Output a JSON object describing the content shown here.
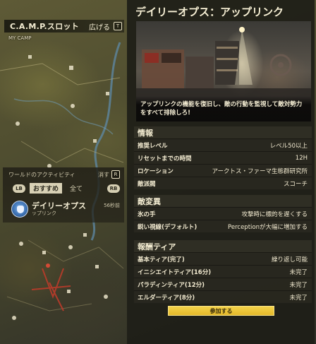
{
  "camp": {
    "title": "C.A.M.P.スロット",
    "expand_label": "広げる",
    "expand_key": "T",
    "my_camp_label": "MY CAMP"
  },
  "activity": {
    "header": "ワールドのアクティビティ",
    "close_label": "消す",
    "close_key": "R",
    "lb_label": "LB",
    "rb_label": "RB",
    "tabs": [
      "おすすめ",
      "全て"
    ],
    "event_title": "デイリーオプス",
    "event_subtitle": "ップリンク",
    "event_time": "56秒前"
  },
  "detail": {
    "title": "デイリーオプス：アップリンク",
    "hero_caption": "アップリンクの機能を復旧し、敵の行動を監視して敵対勢力をすべて排除しろ!",
    "info_header": "情報",
    "info_rows": [
      {
        "label": "推奨レベル",
        "value": "レベル50以上"
      },
      {
        "label": "リセットまでの時間",
        "value": "12H"
      },
      {
        "label": "ロケーション",
        "value": "アークトス・ファーマ生態群研究所"
      },
      {
        "label": "敵派閥",
        "value": "スコーチ"
      }
    ],
    "mutation_header": "敵変異",
    "mutation_rows": [
      {
        "label": "氷の手",
        "value": "攻撃時に標的を遅くする"
      },
      {
        "label": "鋭い視線(デフォルト)",
        "value": "Perceptionが大幅に増加する"
      }
    ],
    "reward_header": "報酬ティア",
    "reward_rows": [
      {
        "label": "基本ティア(完了)",
        "value": "繰り返し可能"
      },
      {
        "label": "イニシエイトティア(16分)",
        "value": "未完了"
      },
      {
        "label": "パラディンティア(12分)",
        "value": "未完了"
      },
      {
        "label": "エルダーティア(8分)",
        "value": "未完了"
      }
    ],
    "join_label": "参加する"
  }
}
